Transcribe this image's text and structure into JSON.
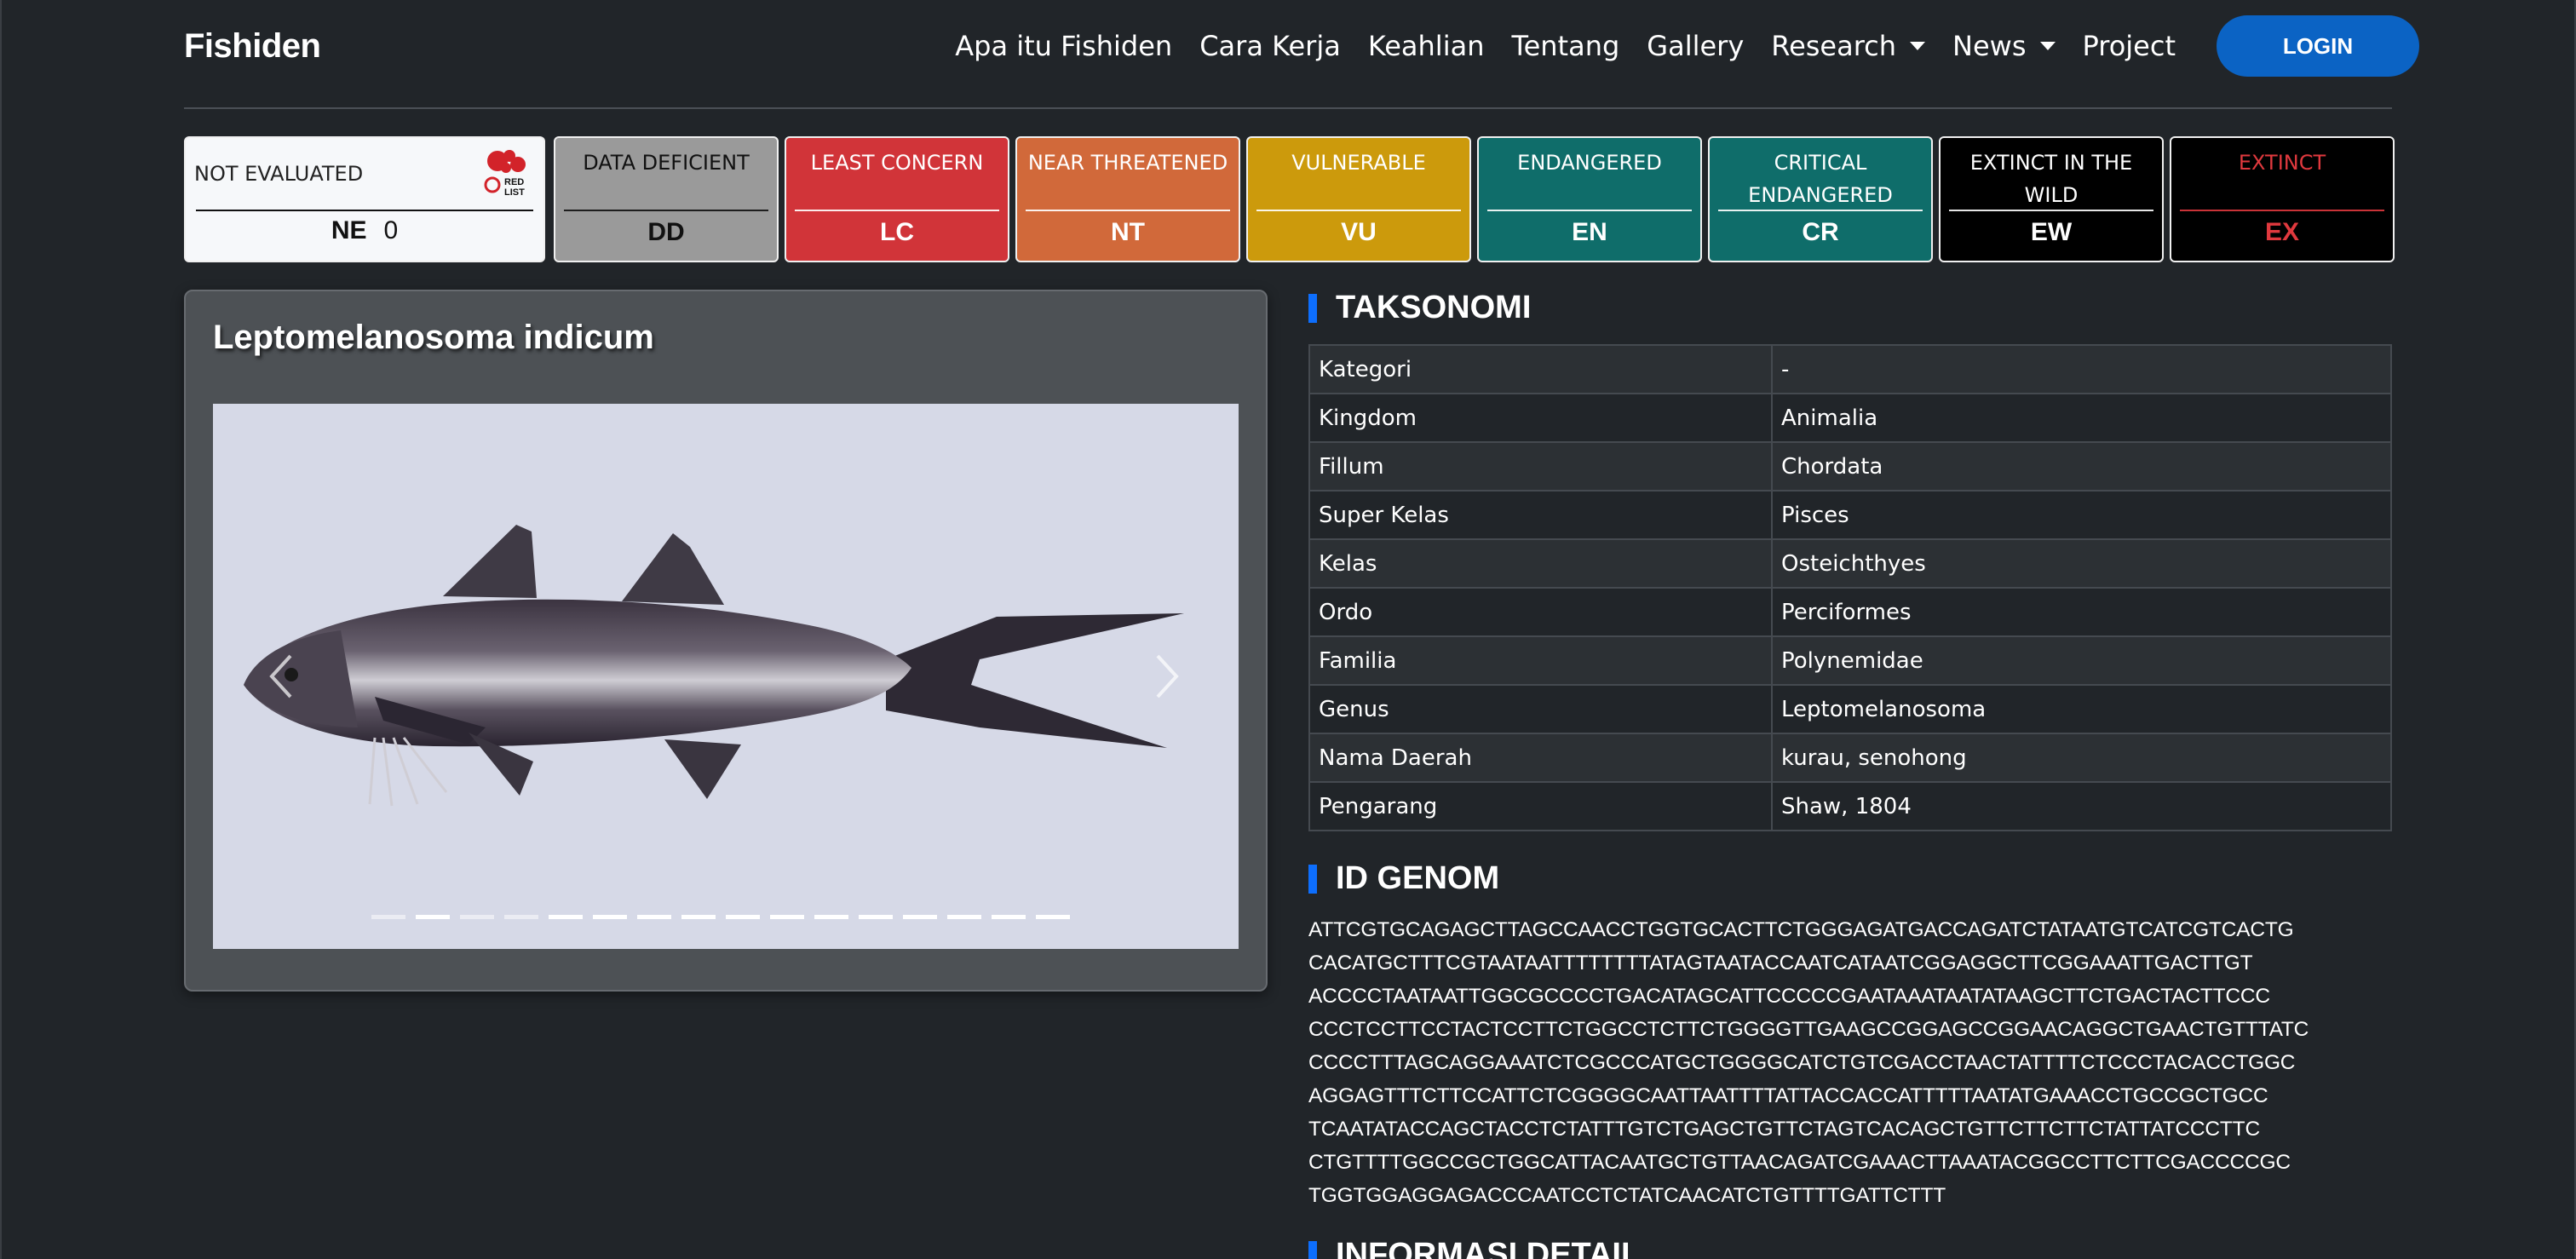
{
  "navbar": {
    "brand": "Fishiden",
    "links": [
      {
        "label": "Apa itu Fishiden"
      },
      {
        "label": "Cara Kerja"
      },
      {
        "label": "Keahlian"
      },
      {
        "label": "Tentang"
      },
      {
        "label": "Gallery"
      },
      {
        "label": "Research",
        "dropdown": true
      },
      {
        "label": "News",
        "dropdown": true
      },
      {
        "label": "Project"
      }
    ],
    "login_label": "LOGIN",
    "login_color": "#0b63c4"
  },
  "status": {
    "not_evaluated": {
      "label": "NOT EVALUATED",
      "code": "NE",
      "count": "0",
      "logo_text": "RED LIST"
    },
    "categories": [
      {
        "label": "DATA DEFICIENT",
        "code": "DD",
        "bg": "#9a9a9a",
        "fg": "#111111"
      },
      {
        "label": "LEAST CONCERN",
        "code": "LC",
        "bg": "#d13439",
        "fg": "#ffffff"
      },
      {
        "label": "NEAR THREATENED",
        "code": "NT",
        "bg": "#d1693a",
        "fg": "#ffffff"
      },
      {
        "label": "VULNERABLE",
        "code": "VU",
        "bg": "#cc9a0c",
        "fg": "#ffffff"
      },
      {
        "label": "ENDANGERED",
        "code": "EN",
        "bg": "#0f6d6a",
        "fg": "#ffffff"
      },
      {
        "label": "CRITICAL ENDANGERED",
        "code": "CR",
        "bg": "#0f6d6a",
        "fg": "#ffffff"
      },
      {
        "label": "EXTINCT IN THE WILD",
        "code": "EW",
        "bg": "#000000",
        "fg": "#ffffff"
      },
      {
        "label": "EXTINCT",
        "code": "EX",
        "bg": "#000000",
        "fg": "#e0393e"
      }
    ]
  },
  "species": {
    "name": "Leptomelanosoma indicum",
    "carousel_slides": 16,
    "active_slide": 2
  },
  "taksonomi": {
    "heading": "TAKSONOMI",
    "rows": [
      {
        "key": "Kategori",
        "value": "-"
      },
      {
        "key": "Kingdom",
        "value": "Animalia"
      },
      {
        "key": "Fillum",
        "value": "Chordata"
      },
      {
        "key": "Super Kelas",
        "value": "Pisces"
      },
      {
        "key": "Kelas",
        "value": "Osteichthyes"
      },
      {
        "key": "Ordo",
        "value": "Perciformes"
      },
      {
        "key": "Familia",
        "value": "Polynemidae"
      },
      {
        "key": "Genus",
        "value": "Leptomelanosoma"
      },
      {
        "key": "Nama Daerah",
        "value": "kurau, senohong"
      },
      {
        "key": "Pengarang",
        "value": "Shaw, 1804"
      }
    ]
  },
  "genom": {
    "heading": "ID GENOM",
    "lines": [
      "ATTCGTGCAGAGCTTAGCCAACCTGGTGCACTTCTGGGAGATGACCAGATCTATAATGTCATCGTCACTG",
      "CACATGCTTTCGTAATAATTTTTTTTATAGTAATACCAATCATAATCGGAGGCTTCGGAAATTGACTTGT",
      "ACCCCTAATAATTGGCGCCCCTGACATAGCATTCCCCCGAATAAATAATATAAGCTTCTGACTACTTCCC",
      "CCCTCCTTCCTACTCCTTCTGGCCTCTTCTGGGGTTGAAGCCGGAGCCGGAACAGGCTGAACTGTTTATC",
      "CCCCTTTAGCAGGAAATCTCGCCCATGCTGGGGCATCTGTCGACCTAACTATTTTCTCCCTACACCTGGC",
      "AGGAGTTTCTTCCATTCTCGGGGCAATTAATTTTATTACCACCATTTTTAATATGAAACCTGCCGCTGCC",
      "TCAATATACCAGCTACCTCTATTTGTCTGAGCTGTTCTAGTCACAGCTGTTCTTCTTCTATTATCCCTTC",
      "CTGTTTTGGCCGCTGGCATTACAATGCTGTTAACAGATCGAAACTTAAATACGGCCTTCTTCGACCCCGC",
      "TGGTGGAGGAGACCCAATCCTCTATCAACATCTGTTTTGATTCTTT"
    ]
  },
  "detail": {
    "heading": "INFORMASI DETAIL"
  }
}
